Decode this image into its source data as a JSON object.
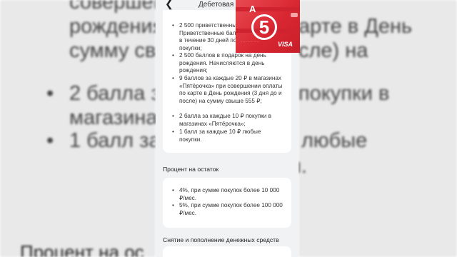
{
  "topbar": {
    "title": "Дебетовая карта"
  },
  "benefits": [
    "2 500 приветственных баллов. Приветственные баллы начисляются в течение 30 дней после первой покупки;",
    "2 500 баллов в подарок на день рождения. Начисляются в день рождения;",
    "9 баллов за каждые 20 ₽ в магазинах «Пятёрочка» при совершении оплаты по карте в День рождения (3 дня до и после) на сумму свыше 555 ₽;",
    "2 балла за каждые 10 ₽ покупки в магазинах «Пятёрочка»;",
    "1 балл за каждые 10 ₽ любые покупки."
  ],
  "interest": {
    "title": "Процент на остаток",
    "items": [
      "4%, при сумме покупок более 10 000 ₽/мес.",
      "5%, при сумме покупок более 100 000 ₽/мес."
    ]
  },
  "withdrawal": {
    "title": "Снятие и пополнение денежных средств"
  },
  "debit_card": {
    "bank_letter": "A",
    "logo_digit": "5",
    "network": "VISA"
  },
  "background": {
    "line_a1": "совершени",
    "line_a2": "рождения",
    "line_a3": "сумму свы",
    "line_a4": "2 балла за",
    "line_a5": "магазинах",
    "line_a6": "1 балл за",
    "line_b1": "арте в День",
    "line_b2": "сле) на",
    "line_b3": "покупки в",
    "line_b4": "любые",
    "line_b5": "покупки.",
    "heading_left": "Процент на ос"
  },
  "colors": {
    "card_red": "#d92732",
    "panel_bg": "#f1f2f4"
  }
}
